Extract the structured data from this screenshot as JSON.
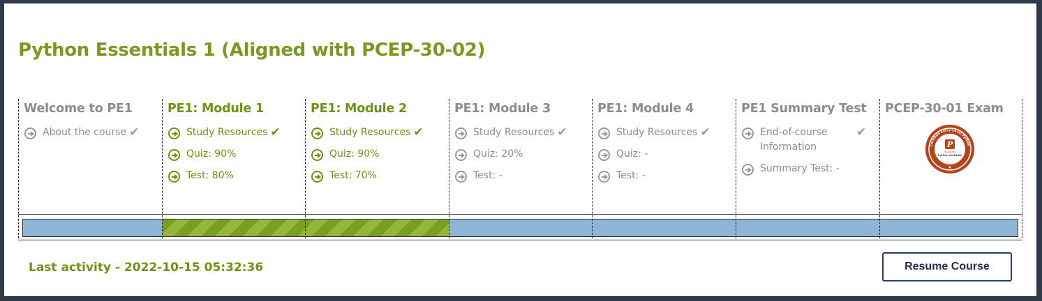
{
  "course": {
    "title": "Python Essentials 1 (Aligned with PCEP-30-02)",
    "last_activity": "Last activity - 2022-10-15 05:32:36",
    "resume_label": "Resume Course"
  },
  "modules": [
    {
      "title": "Welcome to PE1",
      "active": false,
      "items": [
        {
          "label": "About the course",
          "check": true
        }
      ]
    },
    {
      "title": "PE1: Module 1",
      "active": true,
      "items": [
        {
          "label": "Study Resources",
          "check": true
        },
        {
          "label": "Quiz: 90%",
          "check": false
        },
        {
          "label": "Test: 80%",
          "check": false
        }
      ]
    },
    {
      "title": "PE1: Module 2",
      "active": true,
      "items": [
        {
          "label": "Study Resources",
          "check": true
        },
        {
          "label": "Quiz: 90%",
          "check": false
        },
        {
          "label": "Test: 70%",
          "check": false
        }
      ]
    },
    {
      "title": "PE1: Module 3",
      "active": false,
      "items": [
        {
          "label": "Study Resources",
          "check": true
        },
        {
          "label": "Quiz: 20%",
          "check": false
        },
        {
          "label": "Test: -",
          "check": false
        }
      ]
    },
    {
      "title": "PE1: Module 4",
      "active": false,
      "items": [
        {
          "label": "Study Resources",
          "check": true
        },
        {
          "label": "Quiz: -",
          "check": false
        },
        {
          "label": "Test: -",
          "check": false
        }
      ]
    },
    {
      "title": "PE1 Summary Test",
      "active": false,
      "items": [
        {
          "label": "End-of-course Information",
          "check": true
        },
        {
          "label": "Summary Test: -",
          "check": false
        }
      ]
    },
    {
      "title": "PCEP-30-01 Exam",
      "active": false,
      "badge_icon": "pcep-badge-icon",
      "badge_text": {
        "top": "Certified Entry-Level Python",
        "mid": "OpenEDG",
        "sub": "Python Institute"
      }
    }
  ],
  "progress": {
    "completed_modules": [
      "PE1: Module 1",
      "PE1: Module 2"
    ]
  },
  "colors": {
    "accent_green": "#6a9411",
    "muted_gray": "#8c8c8c",
    "progress_blue": "#8fb5d6",
    "button_navy": "#2b3f6b",
    "badge_brown": "#b4441c"
  },
  "icons": {
    "item_arrow": "arrow-circle-right-icon",
    "complete": "check-icon"
  }
}
